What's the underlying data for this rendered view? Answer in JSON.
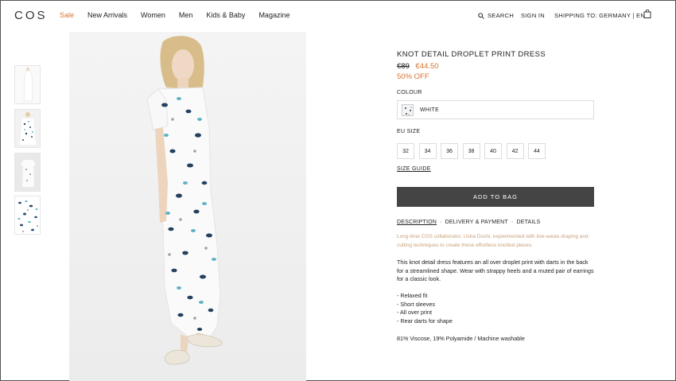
{
  "brand": {
    "logo": "COS"
  },
  "nav": {
    "items": [
      {
        "label": "Sale"
      },
      {
        "label": "New Arrivals"
      },
      {
        "label": "Women"
      },
      {
        "label": "Men"
      },
      {
        "label": "Kids & Baby"
      },
      {
        "label": "Magazine"
      }
    ],
    "search_label": "SEARCH",
    "sign_in_label": "SIGN IN",
    "shipping_label": "SHIPPING TO: GERMANY | EN"
  },
  "product": {
    "title": "KNOT DETAIL DROPLET PRINT DRESS",
    "old_price": "€89",
    "new_price": "€44.50",
    "discount": "50% OFF",
    "colour_label": "COLOUR",
    "colour_value": "WHITE",
    "size_label": "EU SIZE",
    "sizes": [
      "32",
      "34",
      "36",
      "38",
      "40",
      "42",
      "44"
    ],
    "size_guide": "SIZE GUIDE",
    "add_to_bag": "ADD TO BAG",
    "tabs": [
      "DESCRIPTION",
      "DELIVERY & PAYMENT",
      "DETAILS"
    ],
    "intro": "Long-time COS collaborator, Usha Doshi, experimented with low-waste draping and cutting techniques to create these effortless knotted pieces.",
    "description": "This knot detail dress features an all over droplet print with darts in the back for a streamlined shape. Wear with strappy heels and a muted pair of earrings for a classic look.",
    "bullets": [
      "- Relaxed fit",
      "- Short sleeves",
      "- All over print",
      "- Rear darts for shape"
    ],
    "material": "81% Viscose, 19% Polyamide / Machine washable"
  },
  "colors": {
    "accent": "#d9732f",
    "button": "#444444",
    "intro_text": "#c9a27a"
  }
}
